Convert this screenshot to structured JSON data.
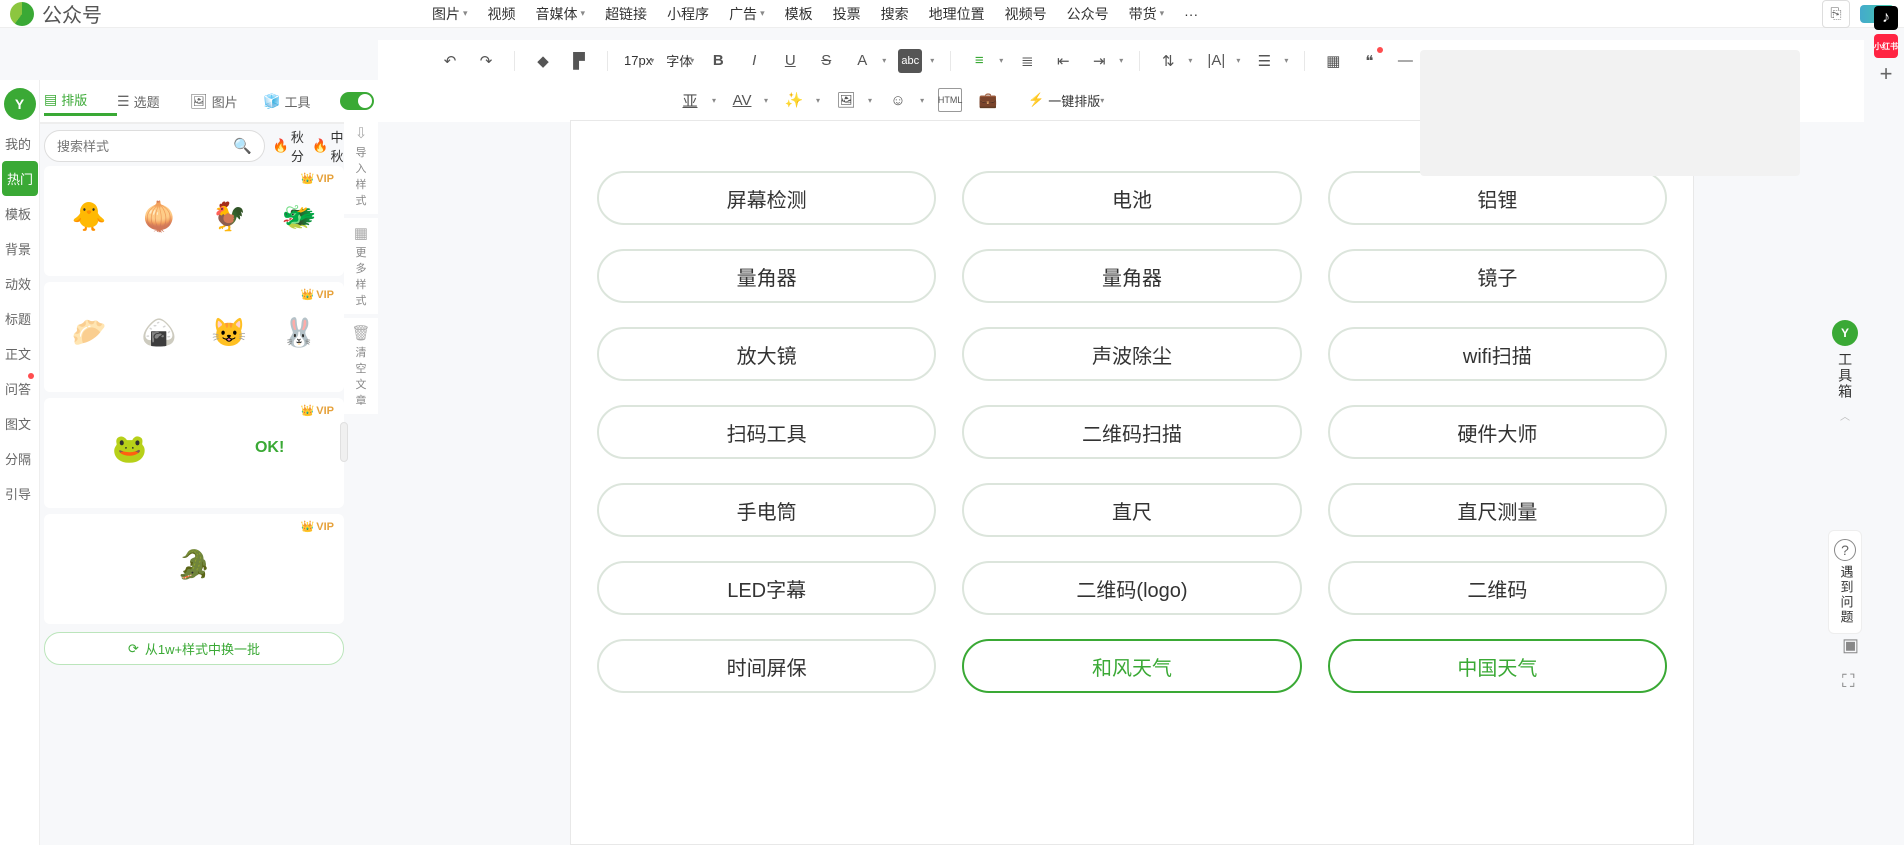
{
  "header": {
    "title": "公众号",
    "nav": [
      "图片",
      "视频",
      "音媒体",
      "超链接",
      "小程序",
      "广告",
      "模板",
      "投票",
      "搜索",
      "地理位置",
      "视频号",
      "公众号",
      "带货",
      "···"
    ],
    "nav_has_caret": [
      true,
      false,
      true,
      false,
      false,
      true,
      false,
      false,
      false,
      false,
      false,
      false,
      true,
      false
    ]
  },
  "tabs": {
    "items": [
      "排版",
      "选题",
      "图片",
      "工具"
    ],
    "activeIndex": 0
  },
  "search": {
    "placeholder": "搜索样式",
    "tags": [
      "秋分",
      "中秋"
    ]
  },
  "rail": {
    "items": [
      "我的",
      "热门",
      "模板",
      "背景",
      "动效",
      "标题",
      "正文",
      "问答",
      "图文",
      "分隔",
      "引导"
    ],
    "activeIndex": 1,
    "dotIndices": [
      7
    ]
  },
  "sideActions": {
    "items": [
      {
        "icon": "⇩",
        "label": "导入样式"
      },
      {
        "icon": "▦",
        "label": "更多样式"
      },
      {
        "icon": "🗑",
        "label": "清空文章"
      }
    ]
  },
  "stickers": {
    "cards": [
      {
        "vip": true,
        "emojis": [
          "🐥",
          "🧅",
          "🐓",
          "🐲"
        ]
      },
      {
        "vip": true,
        "emojis": [
          "🥟",
          "🍙",
          "😺",
          "🐰"
        ]
      },
      {
        "vip": true,
        "emojis": [
          "🐸"
        ],
        "extra": "OK!"
      },
      {
        "vip": true,
        "emojis": [
          "🐊"
        ],
        "extra": ""
      }
    ],
    "vip_label": "VIP",
    "refresh": "从1w+样式中换一批"
  },
  "toolbar": {
    "fontSize": "17px",
    "fontFamily": "字体",
    "oneClick": "一键排版"
  },
  "editor": {
    "chips": [
      {
        "t": "屏幕检测",
        "s": false
      },
      {
        "t": "电池",
        "s": false
      },
      {
        "t": "铝锂",
        "s": false
      },
      {
        "t": "量角器",
        "s": false
      },
      {
        "t": "量角器",
        "s": false
      },
      {
        "t": "镜子",
        "s": false
      },
      {
        "t": "放大镜",
        "s": false
      },
      {
        "t": "声波除尘",
        "s": false
      },
      {
        "t": "wifi扫描",
        "s": false
      },
      {
        "t": "扫码工具",
        "s": false
      },
      {
        "t": "二维码扫描",
        "s": false
      },
      {
        "t": "硬件大师",
        "s": false
      },
      {
        "t": "手电筒",
        "s": false
      },
      {
        "t": "直尺",
        "s": false
      },
      {
        "t": "直尺测量",
        "s": false
      },
      {
        "t": "LED字幕",
        "s": false
      },
      {
        "t": "二维码(logo)",
        "s": false
      },
      {
        "t": "二维码",
        "s": false
      },
      {
        "t": "时间屏保",
        "s": false
      },
      {
        "t": "和风天气",
        "s": true
      },
      {
        "t": "中国天气",
        "s": true
      }
    ]
  },
  "rightRail": {
    "toolbox": "工具箱",
    "help": "遇到问题"
  }
}
